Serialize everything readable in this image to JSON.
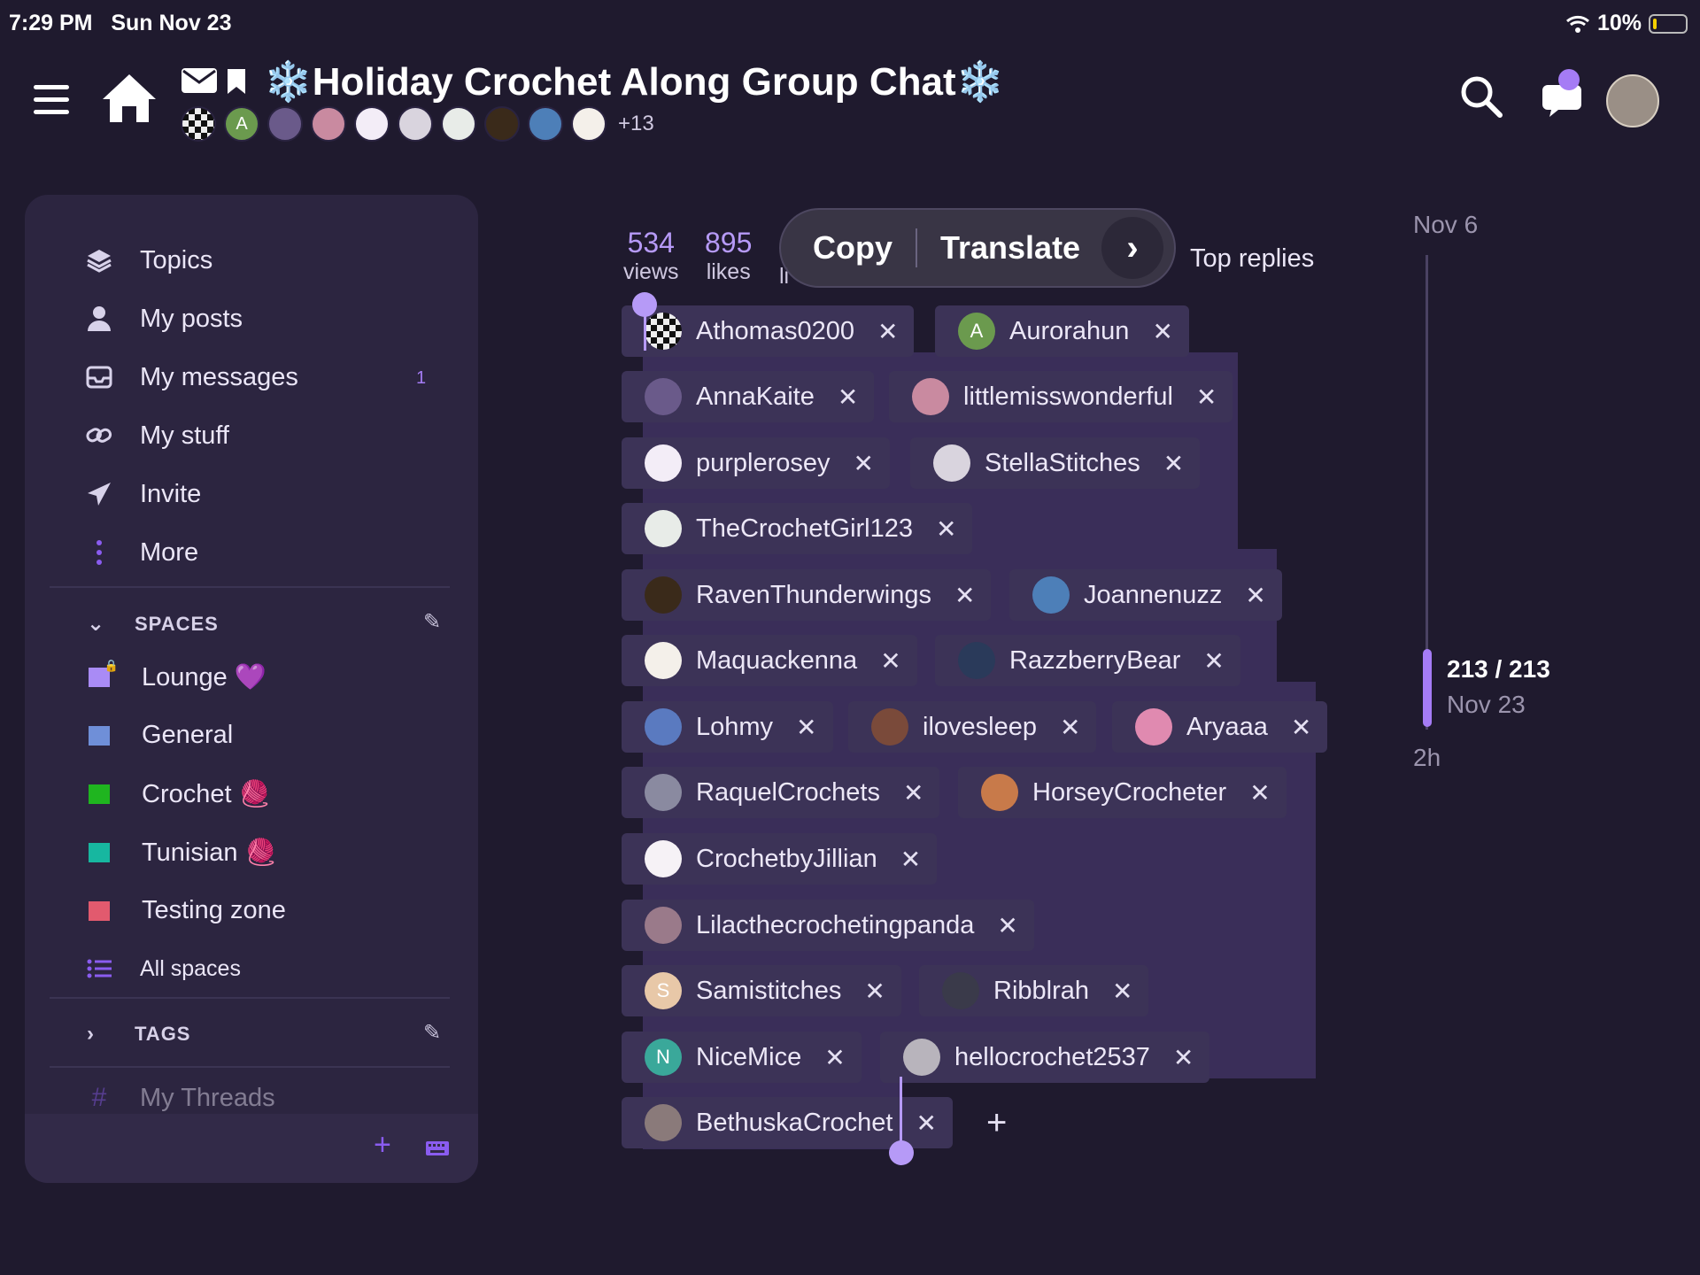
{
  "status_bar": {
    "time": "7:29 PM",
    "date": "Sun Nov 23",
    "battery": "10%"
  },
  "header": {
    "title": "❄️Holiday Crochet Along Group Chat❄️",
    "participants_more": "+13",
    "participant_initials": [
      "A"
    ]
  },
  "sidebar": {
    "nav": [
      {
        "label": "Topics",
        "icon": "layers-icon"
      },
      {
        "label": "My posts",
        "icon": "user-icon"
      },
      {
        "label": "My messages",
        "icon": "inbox-icon",
        "badge": "1"
      },
      {
        "label": "My stuff",
        "icon": "link-icon"
      },
      {
        "label": "Invite",
        "icon": "paper-plane-icon"
      },
      {
        "label": "More",
        "icon": "vertical-dots-icon"
      }
    ],
    "spaces_heading": "SPACES",
    "spaces": [
      {
        "label": "Lounge 💜",
        "color": "#a98bf5",
        "locked": true
      },
      {
        "label": "General",
        "color": "#6f8fd8"
      },
      {
        "label": "Crochet 🧶",
        "color": "#1fb51f"
      },
      {
        "label": "Tunisian 🧶",
        "color": "#17b7a0"
      },
      {
        "label": "Testing zone",
        "color": "#e25a6e"
      }
    ],
    "all_spaces": "All spaces",
    "tags_heading": "TAGS",
    "my_threads": "My Threads"
  },
  "stats": {
    "views": "534",
    "views_label": "views",
    "likes": "895",
    "likes_label": "likes",
    "links_label_partial": "li",
    "top_replies": "Top replies"
  },
  "popup": {
    "copy": "Copy",
    "translate": "Translate"
  },
  "participants": [
    "Athomas0200",
    "Aurorahun",
    "AnnaKaite",
    "littlemisswonderful",
    "purplerosey",
    "StellaStitches",
    "TheCrochetGirl123",
    "RavenThunderwings",
    "Joannenuzz",
    "Maquackenna",
    "RazzberryBear",
    "Lohmy",
    "ilovesleep",
    "Aryaaa",
    "RaquelCrochets",
    "HorseyCrocheter",
    "CrochetbyJillian",
    "Lilacthecrochetingpanda",
    "Samistitches",
    "Ribblrah",
    "NiceMice",
    "hellocrochet2537",
    "BethuskaCrochet"
  ],
  "chip_initials": {
    "aurorahun": "A",
    "samistitches": "S",
    "nicemice": "N"
  },
  "timeline": {
    "start": "Nov 6",
    "position": "213 / 213",
    "date": "Nov 23",
    "ago": "2h"
  },
  "colors": {
    "accent": "#a57cf5",
    "background": "#1f1a2e",
    "sidebar": "#2c2540"
  }
}
